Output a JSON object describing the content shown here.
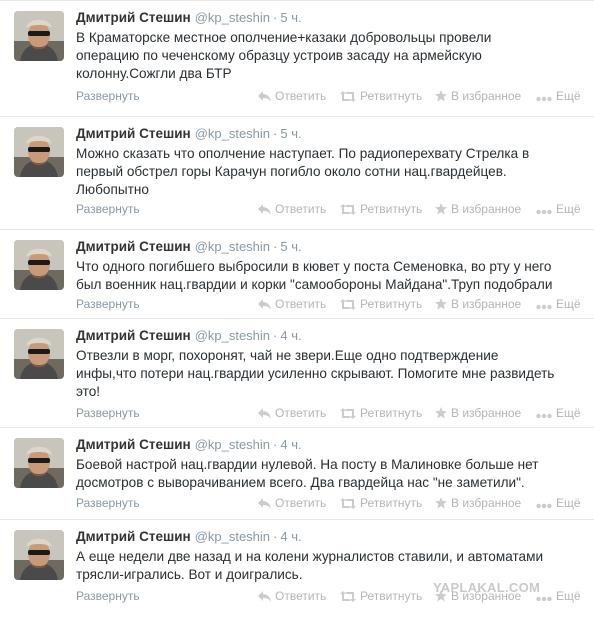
{
  "author": {
    "name": "Дмитрий Стешин",
    "handle": "@kp_steshin"
  },
  "labels": {
    "expand": "Развернуть",
    "reply": "Ответить",
    "retweet": "Ретвитнуть",
    "favorite": "В избранное",
    "more": "Ещё"
  },
  "tweets": [
    {
      "time": "5 ч.",
      "lines": [
        "В Краматорске местное ополчение+казаки добровольцы провели",
        "операцию по чеченскому образцу устроив засаду на армейскую",
        "колонну.Сожгли два БТР"
      ]
    },
    {
      "time": "5 ч.",
      "lines": [
        "Можно сказать что ополчение наступает. По радиоперехвату Стрелка в",
        "первый обстрел горы Карачун погибло около сотни нац.гвардейцев.",
        "Любопытно"
      ]
    },
    {
      "time": "5 ч.",
      "lines": [
        "Что одного погибшего выбросили в кювет у поста Семеновка, во рту у него",
        "был военник нац.гвардии и корки \"самообороны Майдана\".Труп подобрали"
      ]
    },
    {
      "time": "4 ч.",
      "lines": [
        "Отвезли в морг, похоронят, чай не звери.Еще одно подтверждение",
        "инфы,что потери нац.гвардии усиленно скрывают. Помогите мне развидеть",
        "это!"
      ]
    },
    {
      "time": "4 ч.",
      "lines": [
        "Боевой настрой нац.гвардии нулевой. На посту в Малиновке больше нет",
        "досмотров с выворачиванием всего. Два гвардейца нас \"не заметили\"."
      ]
    },
    {
      "time": "4 ч.",
      "lines": [
        "А еще недели две назад и на колени журналистов ставили, и автоматами",
        "трясли-игрались. Вот и доигрались."
      ]
    }
  ],
  "watermark": "YAPLAKAL.COM"
}
